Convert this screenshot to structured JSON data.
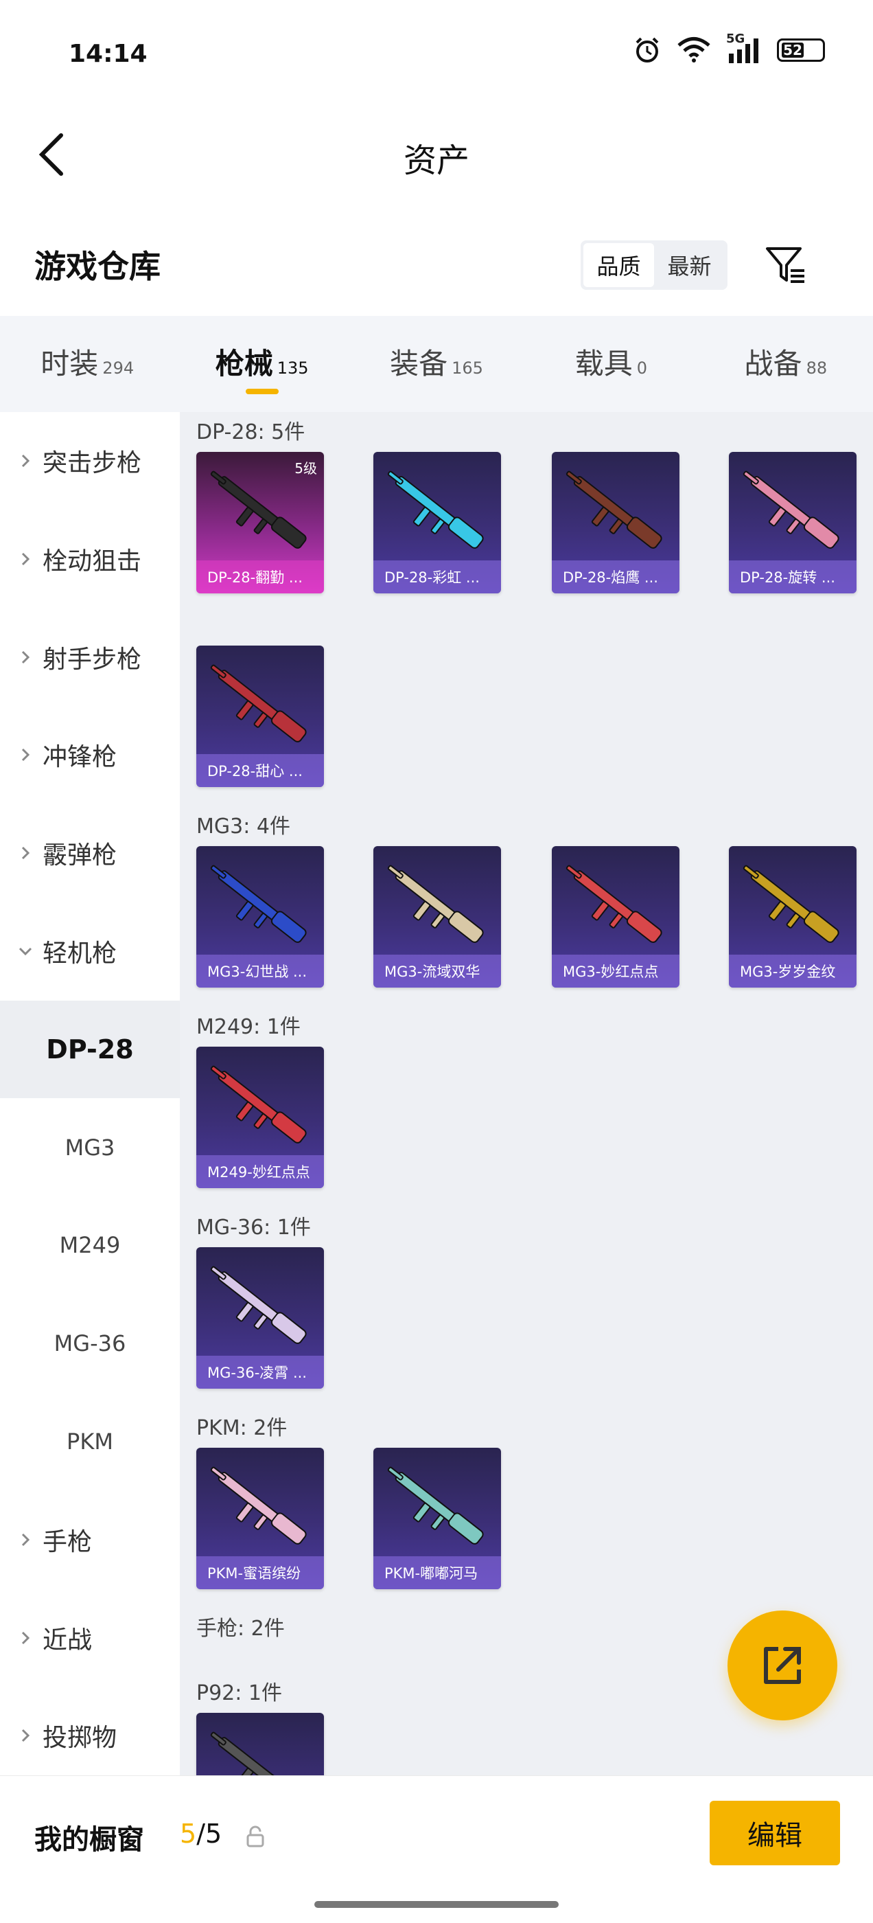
{
  "status": {
    "time": "14:14",
    "network": "5G",
    "battery": "52"
  },
  "nav": {
    "title": "资产"
  },
  "warehouse": {
    "title": "游戏仓库",
    "sort": [
      "品质",
      "最新"
    ],
    "sort_active": 0
  },
  "tabs": [
    {
      "label": "时装",
      "count": "294"
    },
    {
      "label": "枪械",
      "count": "135"
    },
    {
      "label": "装备",
      "count": "165"
    },
    {
      "label": "载具",
      "count": "0"
    },
    {
      "label": "战备",
      "count": "88"
    }
  ],
  "tabs_active": 1,
  "sidebar": [
    {
      "label": "突击步枪",
      "type": "category"
    },
    {
      "label": "栓动狙击",
      "type": "category"
    },
    {
      "label": "射手步枪",
      "type": "category"
    },
    {
      "label": "冲锋枪",
      "type": "category"
    },
    {
      "label": "霰弹枪",
      "type": "category"
    },
    {
      "label": "轻机枪",
      "type": "category-open"
    },
    {
      "label": "DP-28",
      "type": "sub-active"
    },
    {
      "label": "MG3",
      "type": "sub"
    },
    {
      "label": "M249",
      "type": "sub"
    },
    {
      "label": "MG-36",
      "type": "sub"
    },
    {
      "label": "PKM",
      "type": "sub"
    },
    {
      "label": "手枪",
      "type": "category"
    },
    {
      "label": "近战",
      "type": "category"
    },
    {
      "label": "投掷物",
      "type": "category"
    }
  ],
  "groups": [
    {
      "title": "DP-28: 5件",
      "items": [
        {
          "name": "DP-28-翻勤 ...",
          "level": "5级",
          "style": "rare",
          "color": "#2b2b2b"
        },
        {
          "name": "DP-28-彩虹 ...",
          "style": "normal",
          "color": "#38c7e6"
        },
        {
          "name": "DP-28-焰鹰 ...",
          "style": "normal",
          "color": "#7a3a2a"
        },
        {
          "name": "DP-28-旋转 ...",
          "style": "normal",
          "color": "#e28aa8"
        },
        {
          "name": "DP-28-甜心 ...",
          "style": "normal",
          "color": "#b8323a"
        }
      ]
    },
    {
      "title": "MG3: 4件",
      "items": [
        {
          "name": "MG3-幻世战 ...",
          "style": "normal",
          "color": "#2c4cc8"
        },
        {
          "name": "MG3-流域双华",
          "style": "normal",
          "color": "#d8c8a6"
        },
        {
          "name": "MG3-妙红点点",
          "style": "normal",
          "color": "#d8474a"
        },
        {
          "name": "MG3-岁岁金纹",
          "style": "normal",
          "color": "#c8a022"
        }
      ]
    },
    {
      "title": "M249: 1件",
      "items": [
        {
          "name": "M249-妙红点点",
          "style": "normal",
          "color": "#d33a42"
        }
      ]
    },
    {
      "title": "MG-36: 1件",
      "items": [
        {
          "name": "MG-36-凌霄 ...",
          "style": "normal",
          "color": "#d8c8e8"
        }
      ]
    },
    {
      "title": "PKM: 2件",
      "items": [
        {
          "name": "PKM-蜜语缤纷",
          "style": "normal",
          "color": "#e8b8d0"
        },
        {
          "name": "PKM-嘟嘟河马",
          "style": "normal",
          "color": "#7ec8c0"
        }
      ]
    },
    {
      "title": "手枪: 2件",
      "items": []
    },
    {
      "title": "P92: 1件",
      "items": [
        {
          "name": "",
          "style": "normal",
          "color": "#555555"
        }
      ]
    }
  ],
  "bottom": {
    "showcase_label": "我的橱窗",
    "showcase_current": "5",
    "showcase_total": "/5",
    "edit_label": "编辑"
  },
  "colors": {
    "accent": "#f5b400"
  }
}
